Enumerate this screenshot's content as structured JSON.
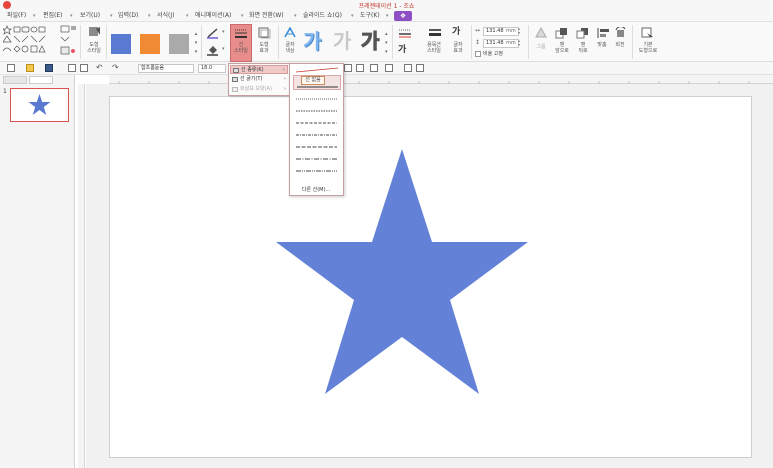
{
  "window": {
    "title": "프레젠테이션 1 - 조쇼"
  },
  "menu": [
    {
      "label": "파일(F)"
    },
    {
      "label": "편집(E)"
    },
    {
      "label": "보기(U)"
    },
    {
      "label": "입력(D)"
    },
    {
      "label": "서식(J)"
    },
    {
      "label": "애니메이션(A)"
    },
    {
      "label": "화면 전환(W)"
    },
    {
      "label": "슬라이드 쇼(Q)"
    },
    {
      "label": "도구(K)"
    }
  ],
  "ribbon": {
    "shape_style_label": "도형\n스타일",
    "line_style_label": "선\n스타일",
    "shape_effect_label": "도형\n효과",
    "text_color_label": "글자\n색상",
    "wordart_style_label": "용묵션\n스타일",
    "text_effect_label": "글자\n효과",
    "width_value": "131.48",
    "height_value": "131.48",
    "unit": "mm",
    "keep_ratio_label": "비율 고정",
    "group_label": "그룹",
    "front_label": "맨\n앞으로",
    "back_label": "맨\n뒤로",
    "align_label": "맞춤",
    "rotate_label": "회전",
    "basic_shape_label": "기본\n도형으로",
    "swatches": [
      "#5a79d0",
      "#f08a33",
      "#aaaaaa"
    ],
    "gaga": "가"
  },
  "toolbar": {
    "font_name": "함초롬돋움",
    "font_size": "18.0"
  },
  "slide_panel": {
    "slide_number": "1"
  },
  "line_menu": {
    "items": [
      {
        "label": "선 종류(K)",
        "active": true
      },
      {
        "label": "선 굵기(T)",
        "active": false
      },
      {
        "label": "화살표 모양(A)",
        "active": false,
        "disabled": true
      }
    ]
  },
  "dash_menu": {
    "tooltip": "선 없음",
    "more_label": "다른 선(M)..."
  },
  "shape": {
    "type": "star",
    "fill": "#6381d6"
  },
  "colors": {
    "accent": "#8e4ec6",
    "highlight": "#e88c8c"
  }
}
